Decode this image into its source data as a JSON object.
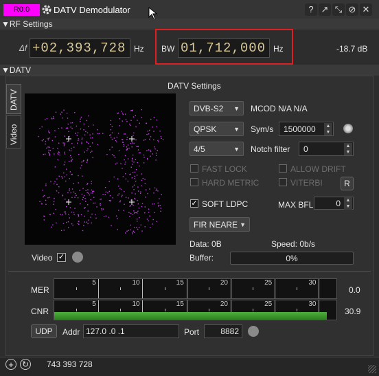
{
  "title": {
    "channel": "R0:0",
    "app_title": "DATV Demodulator",
    "buttons": [
      "?",
      "↗",
      "⤡",
      "⊘",
      "✕"
    ]
  },
  "rf": {
    "section_label": "RF Settings",
    "delta_label": "Δf",
    "delta_value": "+02,393,728",
    "delta_unit": "Hz",
    "bw_label": "BW",
    "bw_value": "01,712,000",
    "bw_unit": "Hz",
    "power": "-18.7 dB"
  },
  "datv": {
    "section_label": "DATV",
    "settings_title": "DATV Settings",
    "tabs": [
      "DATV",
      "Video"
    ],
    "standard": "DVB-S2",
    "modcod": "MCOD N/A N/A",
    "modulation": "QPSK",
    "symrate_label": "Sym/s",
    "symrate": "1500000",
    "fec": "4/5",
    "notch_label": "Notch filter",
    "notch": "0",
    "fast_lock": "FAST LOCK",
    "allow_drift": "ALLOW DRIFT",
    "hard_metric": "HARD METRIC",
    "viterbi": "VITERBI",
    "reset": "R",
    "soft_ldpc": "SOFT LDPC",
    "soft_ldpc_checked": true,
    "maxbfl_label": "MAX BFL",
    "maxbfl": "0",
    "filter": "FIR NEARE",
    "data_label": "Data: 0B",
    "speed_label": "Speed: 0b/s",
    "buffer_label": "Buffer:",
    "buffer_value": "0%",
    "buffer_fraction": 0,
    "video_label": "Video",
    "video_checked": true,
    "video_check": "✓"
  },
  "meters": {
    "mer_label": "MER",
    "mer_value": "0.0",
    "cnr_label": "CNR",
    "cnr_value": "30.9",
    "ticks": [
      "5",
      "10",
      "15",
      "20",
      "25",
      "30"
    ],
    "scale_range": [
      0,
      32
    ],
    "mer_level": 0,
    "cnr_level": 30.9
  },
  "udp": {
    "button": "UDP",
    "addr_label": "Addr",
    "addr": "127.0 .0 .1",
    "port_label": "Port",
    "port": "8882"
  },
  "footer": {
    "frequency": "743 393 728"
  },
  "colors": {
    "channel_bg": "#ff00ff",
    "highlight": "#e02020",
    "cnr_bar": "#3f9f2f",
    "constellation_point": "#c040e0"
  }
}
